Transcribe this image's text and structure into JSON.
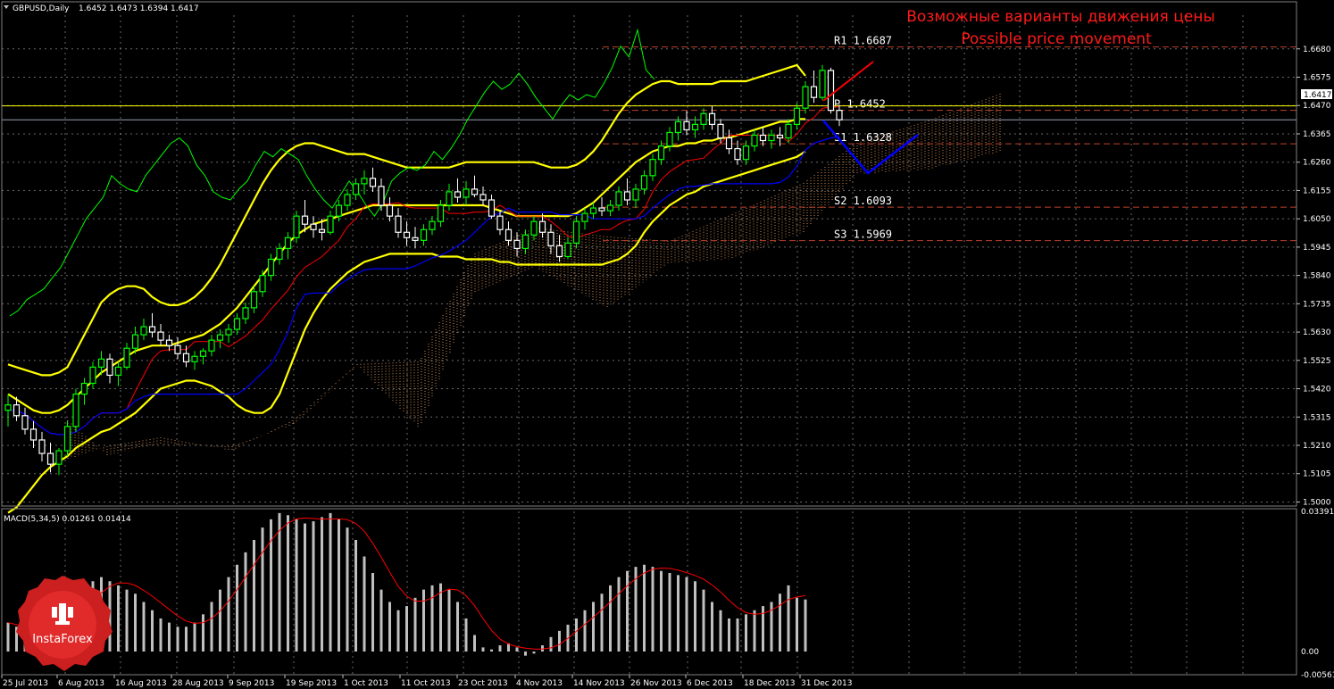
{
  "header": {
    "symbol_label": "GBPUSD,Daily",
    "ohlc_label": "1.6452 1.6473 1.6394 1.6417",
    "dropdown_icon": "triangle-down-icon"
  },
  "annotation": {
    "title_ru": "Возможные варианты движения цены",
    "title_en": "Possible price movement",
    "color": "#ff1a1a"
  },
  "levels": [
    {
      "label": "R1",
      "value": "1.6687",
      "v": 1.6687
    },
    {
      "label": "P",
      "value": "1.6452",
      "v": 1.6452
    },
    {
      "label": "S1",
      "value": "1.6328",
      "v": 1.6328
    },
    {
      "label": "S2",
      "value": "1.6093",
      "v": 1.6093
    },
    {
      "label": "S3",
      "value": "1.5969",
      "v": 1.5969
    }
  ],
  "current_price": "1.6417",
  "yellow_hline": 1.6452,
  "price_axis": {
    "ticks": [
      "1.6680",
      "1.6575",
      "1.6470",
      "1.6365",
      "1.6260",
      "1.6155",
      "1.6050",
      "1.5945",
      "1.5840",
      "1.5735",
      "1.5630",
      "1.5525",
      "1.5420",
      "1.5315",
      "1.5210",
      "1.5105",
      "1.5000"
    ],
    "ylim": [
      1.4985,
      1.6805
    ]
  },
  "macd": {
    "label": "MACD(5,34,5) 0.01261 0.01414",
    "ticks": [
      "0.03391",
      "0.00",
      "-0.00561"
    ],
    "ylim": [
      -0.00561,
      0.03391
    ]
  },
  "time_axis": {
    "labels": [
      "25 Jul 2013",
      "6 Aug 2013",
      "16 Aug 2013",
      "28 Aug 2013",
      "9 Sep 2013",
      "19 Sep 2013",
      "1 Oct 2013",
      "11 Oct 2013",
      "23 Oct 2013",
      "4 Nov 2013",
      "14 Nov 2013",
      "26 Nov 2013",
      "6 Dec 2013",
      "18 Dec 2013",
      "31 Dec 2013"
    ]
  },
  "logo": {
    "text": "InstaForex",
    "icon": "instaforex-logo-icon"
  },
  "colors": {
    "bull": "#00ff00",
    "bear": "#ffffff",
    "bollinger": "#ffff00",
    "tenkan": "#ff0000",
    "kijun": "#0000ff",
    "chikou": "#00ff00",
    "cloud": "#f4a460",
    "grid": "#c0c0c0",
    "forecast_up": "#ff0000",
    "forecast_down": "#0000ff",
    "levels": "#c0402b",
    "macd_hist": "#c0c0c0",
    "macd_signal": "#ff0000"
  },
  "chart_data": {
    "type": "candlestick",
    "instrument": "GBPUSD",
    "timeframe": "Daily",
    "candles": [
      [
        1.534,
        1.54,
        1.528,
        1.536
      ],
      [
        1.536,
        1.539,
        1.53,
        1.532
      ],
      [
        1.532,
        1.535,
        1.525,
        1.527
      ],
      [
        1.527,
        1.53,
        1.52,
        1.523
      ],
      [
        1.523,
        1.526,
        1.515,
        1.518
      ],
      [
        1.518,
        1.522,
        1.511,
        1.514
      ],
      [
        1.514,
        1.52,
        1.51,
        1.519
      ],
      [
        1.519,
        1.53,
        1.517,
        1.528
      ],
      [
        1.528,
        1.542,
        1.526,
        1.54
      ],
      [
        1.54,
        1.546,
        1.536,
        1.544
      ],
      [
        1.544,
        1.552,
        1.542,
        1.55
      ],
      [
        1.55,
        1.556,
        1.547,
        1.553
      ],
      [
        1.553,
        1.555,
        1.544,
        1.547
      ],
      [
        1.547,
        1.552,
        1.543,
        1.55
      ],
      [
        1.55,
        1.559,
        1.549,
        1.557
      ],
      [
        1.557,
        1.565,
        1.555,
        1.562
      ],
      [
        1.562,
        1.568,
        1.56,
        1.565
      ],
      [
        1.565,
        1.57,
        1.561,
        1.563
      ],
      [
        1.563,
        1.566,
        1.558,
        1.56
      ],
      [
        1.56,
        1.562,
        1.556,
        1.558
      ],
      [
        1.558,
        1.561,
        1.553,
        1.555
      ],
      [
        1.555,
        1.558,
        1.55,
        1.552
      ],
      [
        1.552,
        1.556,
        1.549,
        1.554
      ],
      [
        1.554,
        1.557,
        1.551,
        1.556
      ],
      [
        1.556,
        1.562,
        1.554,
        1.56
      ],
      [
        1.56,
        1.564,
        1.557,
        1.562
      ],
      [
        1.562,
        1.566,
        1.559,
        1.564
      ],
      [
        1.564,
        1.57,
        1.562,
        1.568
      ],
      [
        1.568,
        1.574,
        1.566,
        1.572
      ],
      [
        1.572,
        1.58,
        1.57,
        1.578
      ],
      [
        1.578,
        1.586,
        1.576,
        1.584
      ],
      [
        1.584,
        1.592,
        1.582,
        1.59
      ],
      [
        1.59,
        1.596,
        1.588,
        1.594
      ],
      [
        1.594,
        1.6,
        1.59,
        1.598
      ],
      [
        1.598,
        1.608,
        1.596,
        1.606
      ],
      [
        1.606,
        1.612,
        1.6,
        1.603
      ],
      [
        1.603,
        1.606,
        1.598,
        1.601
      ],
      [
        1.601,
        1.605,
        1.597,
        1.6
      ],
      [
        1.6,
        1.608,
        1.599,
        1.606
      ],
      [
        1.606,
        1.612,
        1.604,
        1.61
      ],
      [
        1.61,
        1.616,
        1.608,
        1.614
      ],
      [
        1.614,
        1.62,
        1.612,
        1.618
      ],
      [
        1.618,
        1.623,
        1.614,
        1.62
      ],
      [
        1.62,
        1.624,
        1.615,
        1.617
      ],
      [
        1.617,
        1.62,
        1.608,
        1.61
      ],
      [
        1.61,
        1.613,
        1.604,
        1.606
      ],
      [
        1.606,
        1.609,
        1.598,
        1.6
      ],
      [
        1.6,
        1.604,
        1.595,
        1.598
      ],
      [
        1.598,
        1.602,
        1.594,
        1.597
      ],
      [
        1.597,
        1.603,
        1.595,
        1.601
      ],
      [
        1.601,
        1.606,
        1.599,
        1.604
      ],
      [
        1.604,
        1.612,
        1.602,
        1.61
      ],
      [
        1.61,
        1.618,
        1.608,
        1.615
      ],
      [
        1.615,
        1.62,
        1.611,
        1.613
      ],
      [
        1.613,
        1.619,
        1.61,
        1.616
      ],
      [
        1.616,
        1.621,
        1.613,
        1.614
      ],
      [
        1.614,
        1.617,
        1.61,
        1.612
      ],
      [
        1.612,
        1.614,
        1.605,
        1.606
      ],
      [
        1.606,
        1.608,
        1.599,
        1.601
      ],
      [
        1.601,
        1.604,
        1.595,
        1.597
      ],
      [
        1.597,
        1.6,
        1.591,
        1.594
      ],
      [
        1.594,
        1.601,
        1.592,
        1.599
      ],
      [
        1.599,
        1.606,
        1.597,
        1.604
      ],
      [
        1.604,
        1.607,
        1.598,
        1.6
      ],
      [
        1.6,
        1.603,
        1.592,
        1.595
      ],
      [
        1.595,
        1.599,
        1.589,
        1.591
      ],
      [
        1.591,
        1.598,
        1.59,
        1.596
      ],
      [
        1.596,
        1.606,
        1.594,
        1.604
      ],
      [
        1.604,
        1.609,
        1.601,
        1.607
      ],
      [
        1.607,
        1.611,
        1.605,
        1.609
      ],
      [
        1.609,
        1.613,
        1.606,
        1.608
      ],
      [
        1.608,
        1.612,
        1.606,
        1.61
      ],
      [
        1.61,
        1.617,
        1.608,
        1.615
      ],
      [
        1.615,
        1.62,
        1.61,
        1.612
      ],
      [
        1.612,
        1.618,
        1.609,
        1.616
      ],
      [
        1.616,
        1.623,
        1.614,
        1.621
      ],
      [
        1.621,
        1.629,
        1.619,
        1.627
      ],
      [
        1.627,
        1.634,
        1.625,
        1.632
      ],
      [
        1.632,
        1.639,
        1.63,
        1.637
      ],
      [
        1.637,
        1.643,
        1.634,
        1.641
      ],
      [
        1.641,
        1.645,
        1.636,
        1.638
      ],
      [
        1.638,
        1.643,
        1.635,
        1.64
      ],
      [
        1.64,
        1.646,
        1.638,
        1.644
      ],
      [
        1.644,
        1.647,
        1.638,
        1.64
      ],
      [
        1.64,
        1.642,
        1.633,
        1.635
      ],
      [
        1.635,
        1.638,
        1.629,
        1.631
      ],
      [
        1.631,
        1.634,
        1.625,
        1.627
      ],
      [
        1.627,
        1.634,
        1.625,
        1.632
      ],
      [
        1.632,
        1.638,
        1.63,
        1.636
      ],
      [
        1.636,
        1.639,
        1.632,
        1.634
      ],
      [
        1.634,
        1.638,
        1.631,
        1.636
      ],
      [
        1.636,
        1.639,
        1.632,
        1.635
      ],
      [
        1.635,
        1.642,
        1.633,
        1.64
      ],
      [
        1.64,
        1.648,
        1.638,
        1.646
      ],
      [
        1.646,
        1.656,
        1.644,
        1.654
      ],
      [
        1.654,
        1.66,
        1.648,
        1.65
      ],
      [
        1.65,
        1.662,
        1.649,
        1.66
      ],
      [
        1.66,
        1.661,
        1.644,
        1.6452
      ],
      [
        1.6452,
        1.6473,
        1.6394,
        1.6417
      ]
    ],
    "macd_hist": [
      0.007,
      0.006,
      0.005,
      0.004,
      0.003,
      0.003,
      0.006,
      0.009,
      0.012,
      0.015,
      0.017,
      0.018,
      0.017,
      0.016,
      0.015,
      0.014,
      0.012,
      0.01,
      0.008,
      0.007,
      0.006,
      0.006,
      0.007,
      0.009,
      0.012,
      0.015,
      0.018,
      0.021,
      0.024,
      0.027,
      0.03,
      0.032,
      0.0335,
      0.033,
      0.032,
      0.031,
      0.0315,
      0.0325,
      0.0335,
      0.032,
      0.03,
      0.027,
      0.023,
      0.019,
      0.015,
      0.012,
      0.01,
      0.011,
      0.013,
      0.015,
      0.016,
      0.0165,
      0.015,
      0.012,
      0.008,
      0.004,
      0.001,
      0.0005,
      0.0015,
      0.002,
      0.001,
      -0.001,
      -0.0005,
      0.0015,
      0.0035,
      0.005,
      0.0065,
      0.008,
      0.01,
      0.012,
      0.014,
      0.016,
      0.018,
      0.0195,
      0.0205,
      0.021,
      0.0205,
      0.0195,
      0.019,
      0.0185,
      0.018,
      0.017,
      0.015,
      0.012,
      0.01,
      0.008,
      0.008,
      0.009,
      0.01,
      0.011,
      0.012,
      0.014,
      0.016,
      0.013,
      0.0126
    ],
    "bollinger_upper": [
      1.551,
      1.55,
      1.549,
      1.548,
      1.547,
      1.547,
      1.548,
      1.55,
      1.556,
      1.562,
      1.568,
      1.574,
      1.577,
      1.579,
      1.58,
      1.58,
      1.579,
      1.576,
      1.574,
      1.573,
      1.573,
      1.574,
      1.576,
      1.579,
      1.583,
      1.588,
      1.594,
      1.6,
      1.606,
      1.612,
      1.618,
      1.623,
      1.627,
      1.63,
      1.632,
      1.633,
      1.633,
      1.632,
      1.631,
      1.63,
      1.629,
      1.629,
      1.629,
      1.628,
      1.627,
      1.626,
      1.625,
      1.624,
      1.624,
      1.624,
      1.624,
      1.624,
      1.624,
      1.625,
      1.626,
      1.626,
      1.626,
      1.626,
      1.626,
      1.626,
      1.626,
      1.626,
      1.626,
      1.625,
      1.624,
      1.624,
      1.624,
      1.625,
      1.627,
      1.63,
      1.634,
      1.639,
      1.644,
      1.648,
      1.651,
      1.653,
      1.655,
      1.656,
      1.656,
      1.655,
      1.655,
      1.655,
      1.655,
      1.655,
      1.656,
      1.656,
      1.656,
      1.656,
      1.657,
      1.658,
      1.659,
      1.66,
      1.661,
      1.662,
      1.658
    ],
    "bollinger_middle": [
      1.54,
      1.538,
      1.536,
      1.534,
      1.533,
      1.533,
      1.534,
      1.536,
      1.539,
      1.542,
      1.545,
      1.548,
      1.55,
      1.552,
      1.554,
      1.556,
      1.557,
      1.558,
      1.558,
      1.558,
      1.559,
      1.56,
      1.561,
      1.562,
      1.564,
      1.566,
      1.569,
      1.572,
      1.576,
      1.58,
      1.584,
      1.588,
      1.592,
      1.596,
      1.599,
      1.601,
      1.603,
      1.604,
      1.605,
      1.606,
      1.607,
      1.608,
      1.609,
      1.61,
      1.61,
      1.61,
      1.61,
      1.61,
      1.61,
      1.61,
      1.61,
      1.61,
      1.61,
      1.61,
      1.61,
      1.61,
      1.61,
      1.609,
      1.608,
      1.607,
      1.606,
      1.606,
      1.606,
      1.606,
      1.606,
      1.606,
      1.606,
      1.607,
      1.609,
      1.611,
      1.614,
      1.617,
      1.62,
      1.623,
      1.626,
      1.628,
      1.63,
      1.631,
      1.632,
      1.632,
      1.633,
      1.633,
      1.634,
      1.634,
      1.635,
      1.635,
      1.636,
      1.637,
      1.638,
      1.639,
      1.64,
      1.641,
      1.641,
      1.642,
      1.642
    ],
    "bollinger_lower": [
      1.496,
      1.498,
      1.502,
      1.506,
      1.51,
      1.513,
      1.515,
      1.517,
      1.52,
      1.522,
      1.524,
      1.526,
      1.527,
      1.529,
      1.531,
      1.533,
      1.536,
      1.539,
      1.542,
      1.543,
      1.544,
      1.545,
      1.545,
      1.544,
      1.543,
      1.541,
      1.539,
      1.536,
      1.534,
      1.533,
      1.533,
      1.535,
      1.54,
      1.548,
      1.556,
      1.564,
      1.57,
      1.575,
      1.579,
      1.582,
      1.585,
      1.587,
      1.589,
      1.59,
      1.591,
      1.592,
      1.592,
      1.592,
      1.592,
      1.592,
      1.592,
      1.591,
      1.591,
      1.591,
      1.59,
      1.59,
      1.59,
      1.59,
      1.589,
      1.589,
      1.588,
      1.588,
      1.588,
      1.588,
      1.588,
      1.588,
      1.588,
      1.588,
      1.588,
      1.588,
      1.588,
      1.589,
      1.59,
      1.592,
      1.595,
      1.6,
      1.604,
      1.607,
      1.61,
      1.612,
      1.614,
      1.615,
      1.617,
      1.618,
      1.619,
      1.62,
      1.621,
      1.622,
      1.623,
      1.624,
      1.625,
      1.626,
      1.627,
      1.628,
      1.63
    ]
  }
}
